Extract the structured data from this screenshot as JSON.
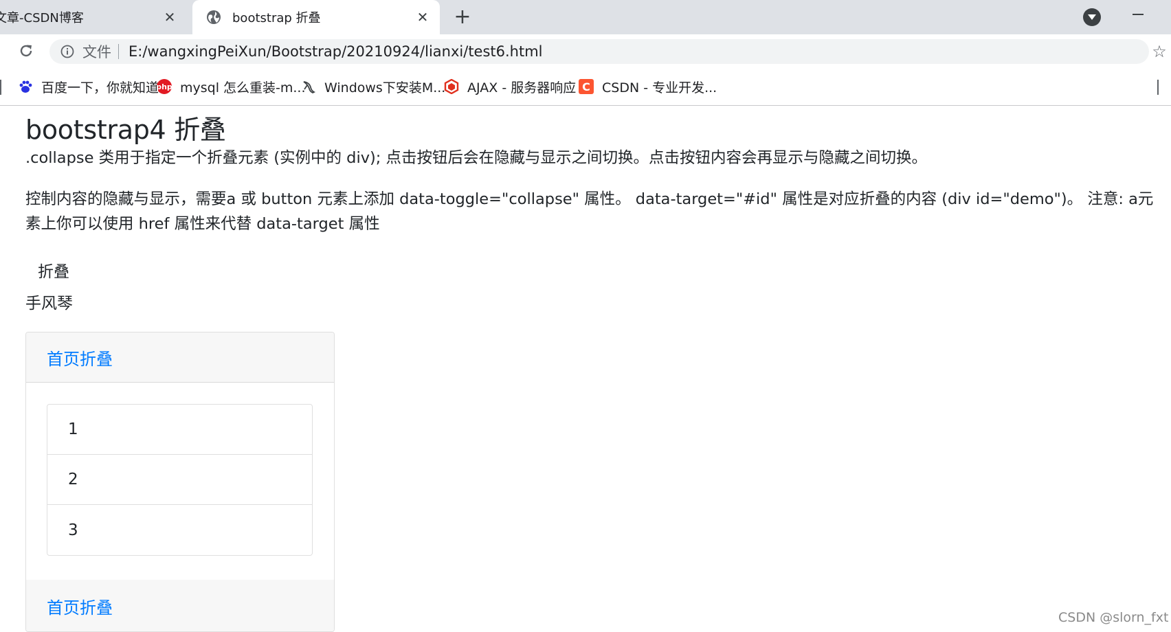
{
  "browser": {
    "tabs": [
      {
        "title": "文章-CSDN博客",
        "active": false
      },
      {
        "title": "bootstrap 折叠",
        "active": true
      }
    ],
    "close_glyph": "✕",
    "new_tab_glyph": "+",
    "address": {
      "scheme_label": "文件",
      "url": "E:/wangxingPeiXun/Bootstrap/20210924/lianxi/test6.html"
    },
    "star_glyph": "☆",
    "bookmarks": [
      {
        "label": "百度一下，你就知道",
        "icon": "baidu-paw-icon",
        "color": "#2932e1"
      },
      {
        "label": "mysql 怎么重装-m...",
        "icon": "php-icon",
        "color": "#e21a23"
      },
      {
        "label": "Windows下安装M...",
        "icon": "mysql-dolphin-icon",
        "color": "#3c4043"
      },
      {
        "label": "AJAX - 服务器响应",
        "icon": "runoob-icon",
        "color": "#e0301e"
      },
      {
        "label": "CSDN - 专业开发...",
        "icon": "csdn-icon",
        "color": "#fc5531"
      }
    ]
  },
  "page": {
    "title": "bootstrap4 折叠",
    "paragraph1": ".collapse 类用于指定一个折叠元素 (实例中的 div); 点击按钮后会在隐藏与显示之间切换。点击按钮内容会再显示与隐藏之间切换。",
    "paragraph2": "控制内容的隐藏与显示，需要a 或 button 元素上添加 data-toggle=\"collapse\" 属性。  data-target=\"#id\" 属性是对应折叠的内容 (div id=\"demo\")。 注意: a元素上你可以使用 href 属性来代替 data-target 属性",
    "collapse_button": "折叠",
    "demo_text": "手风琴",
    "card": {
      "header_link": "首页折叠",
      "items": [
        "1",
        "2",
        "3"
      ],
      "footer_link": "首页折叠"
    },
    "link_color": "#007bff"
  },
  "watermark": "CSDN @slorn_fxt"
}
